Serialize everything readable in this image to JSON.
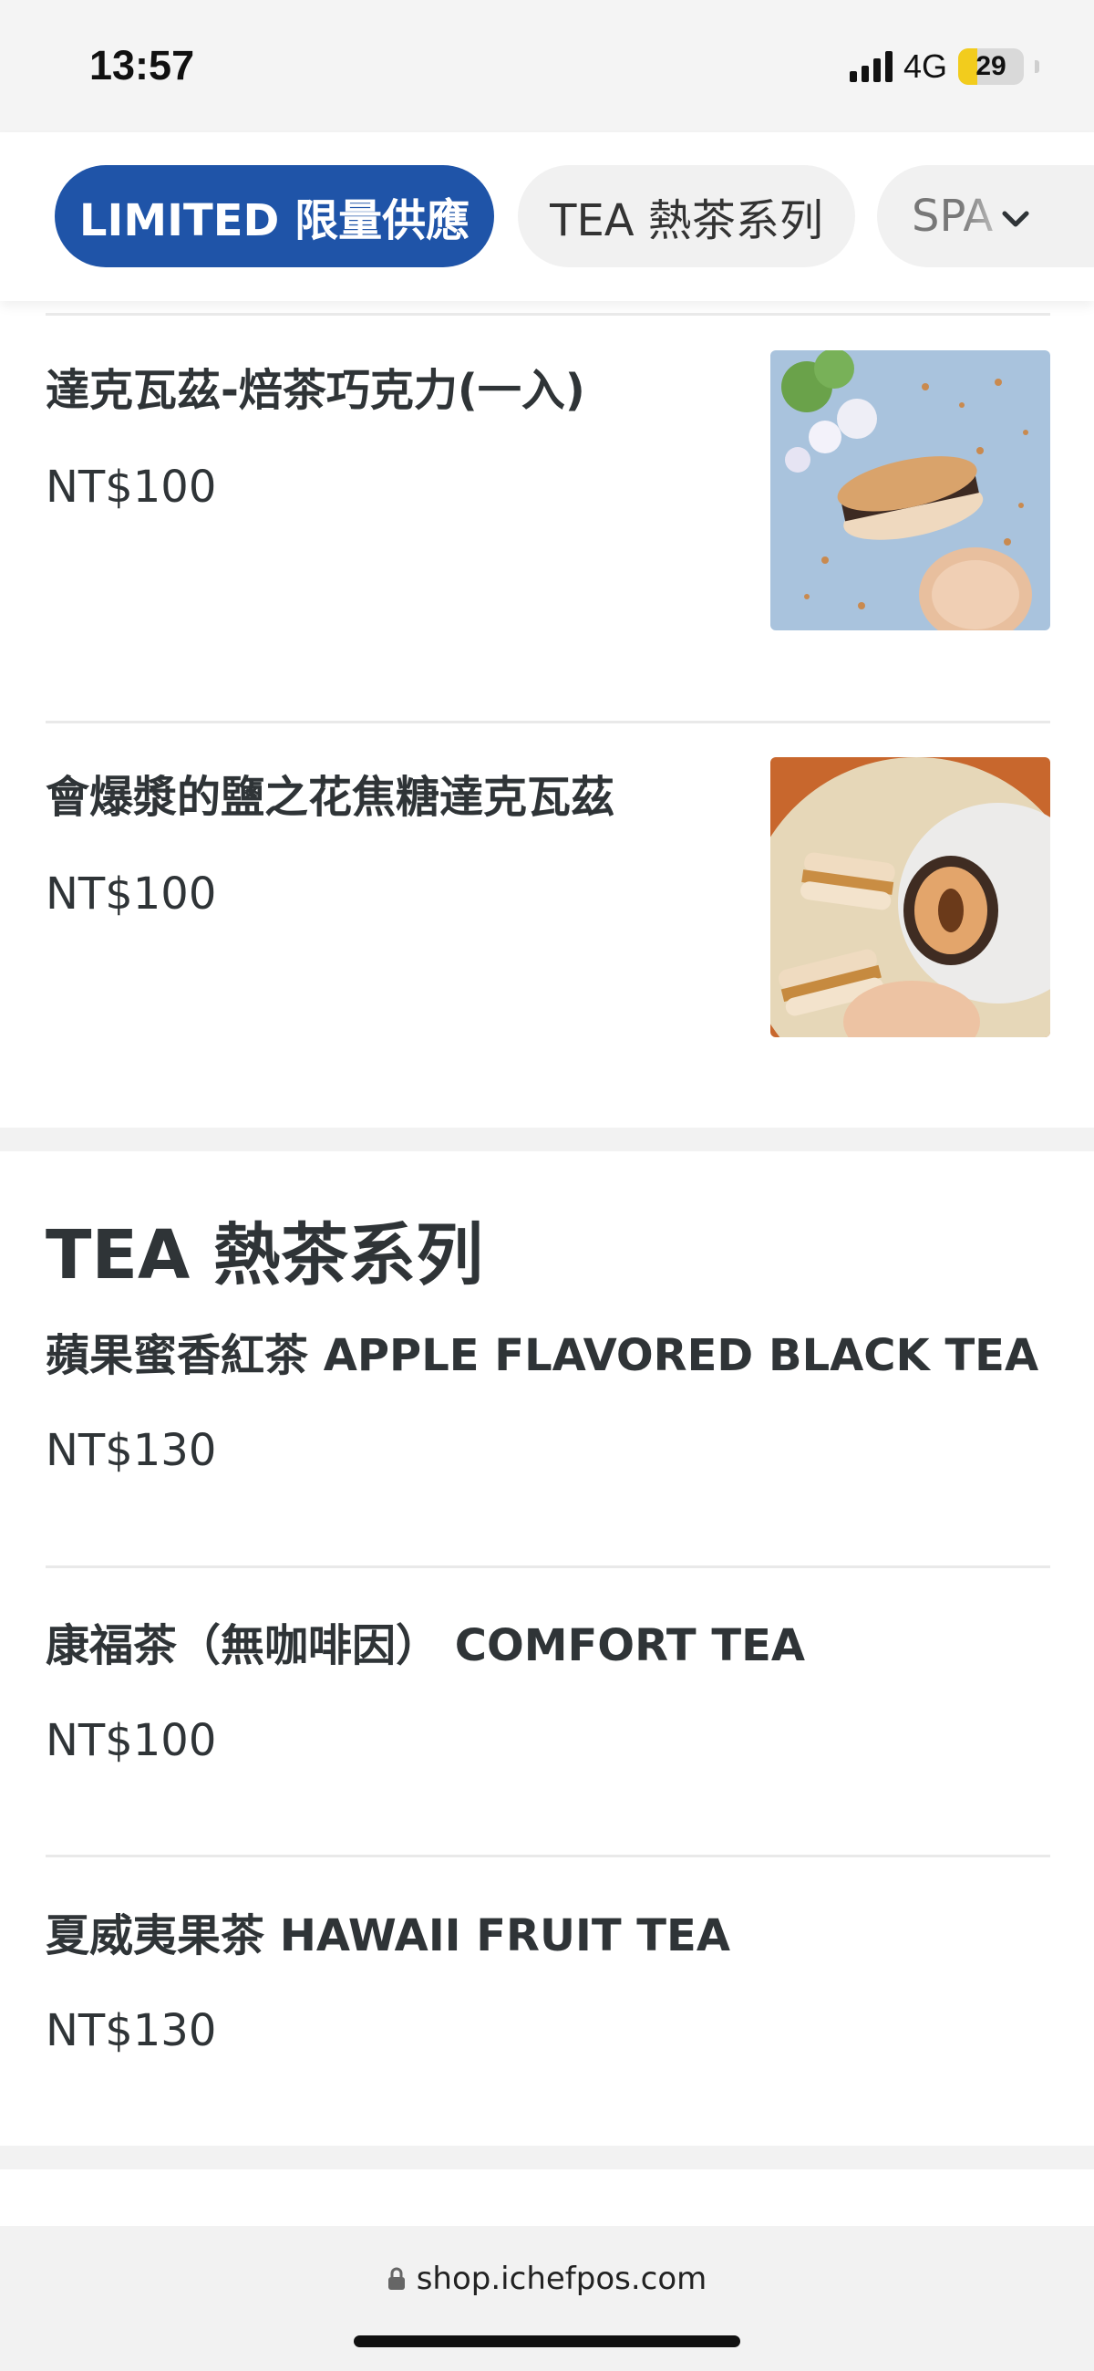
{
  "status": {
    "time": "13:57",
    "network": "4G",
    "battery": "29",
    "battery_level": 0.29
  },
  "nav": {
    "tabs": [
      {
        "label": "LIMITED 限量供應",
        "active": true
      },
      {
        "label": "TEA 熱茶系列",
        "active": false
      },
      {
        "label": "SPA",
        "active": false
      }
    ],
    "more_icon": "chevron-down-icon"
  },
  "limited_items": [
    {
      "name": "達克瓦茲-焙茶巧克力(一入)",
      "price": "NT$100"
    },
    {
      "name": "會爆漿的鹽之花焦糖達克瓦茲",
      "price": "NT$100"
    }
  ],
  "tea_section": {
    "title": "TEA 熱茶系列",
    "items": [
      {
        "name": "蘋果蜜香紅茶 APPLE FLAVORED BLACK TEA",
        "price": "NT$130"
      },
      {
        "name": "康福茶（無咖啡因） COMFORT TEA",
        "price": "NT$100"
      },
      {
        "name": "夏威夷果茶 HAWAII FRUIT TEA",
        "price": "NT$130"
      }
    ]
  },
  "browser": {
    "url": "shop.ichefpos.com",
    "lock_icon": "lock-icon"
  },
  "colors": {
    "accent": "#1f54a8",
    "text": "#2f3437",
    "battery": "#f2cc1d"
  }
}
